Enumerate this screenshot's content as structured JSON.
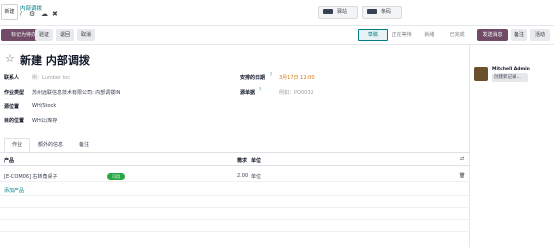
{
  "topbar": {
    "new_label": "新建",
    "breadcrumb_parent": "内部调拨",
    "breadcrumb_current": "/",
    "chip1_label": "驿站",
    "chip2_label": "条码"
  },
  "actions": {
    "mark_todo": "标记为待办",
    "validate": "验证",
    "return": "退回",
    "cancel": "取消",
    "send_message": "发送消息",
    "note": "备注",
    "activity": "活动"
  },
  "status": [
    "草稿",
    "正在等待",
    "就绪",
    "已完成"
  ],
  "form": {
    "title": "新建 内部调拨",
    "contact_label": "联系人",
    "contact_placeholder": "例：Lumber Inc",
    "op_type_label": "作业类型",
    "op_type_value": "苏州远联信息技术有限公司: 内部调拨IN",
    "src_label": "源位置",
    "src_value": "WH/Stock",
    "dest_label": "目的位置",
    "dest_value": "WH公/库存",
    "sched_label": "安排的日期",
    "sched_sup": "?",
    "sched_value": "3月17日 12:00",
    "source_doc_label": "源单据",
    "source_doc_sup": "?",
    "source_doc_placeholder": "例如：PO0032"
  },
  "tabs": [
    "作业",
    "额外的信息",
    "备注"
  ],
  "table": {
    "col_product": "产品",
    "col_demand": "需求",
    "col_unit": "单位",
    "rows": [
      {
        "product": "[E-COM06] 右转角桌子",
        "badge": "可用",
        "demand": "2.00",
        "unit": "单位"
      }
    ],
    "add_line": "添加产品"
  },
  "chatter": {
    "author": "Mitchell Admin",
    "message": "创建新记录..."
  }
}
